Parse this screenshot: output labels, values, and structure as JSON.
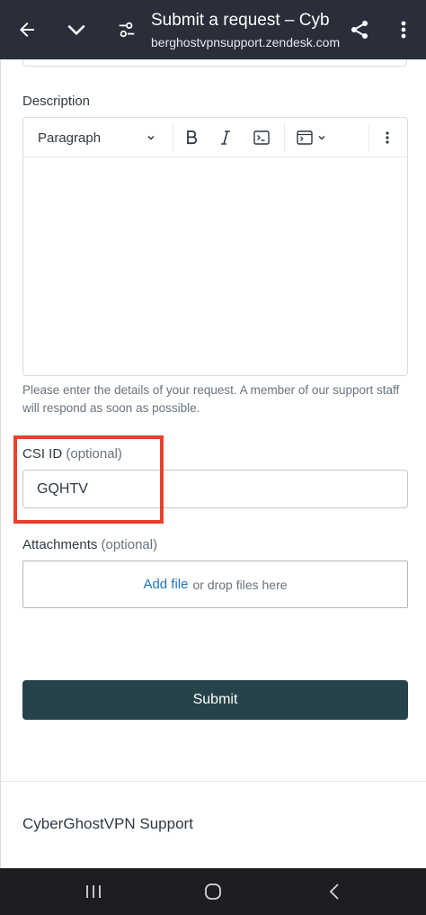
{
  "browser": {
    "title": "Submit a request – Cyb",
    "url": "berghostvpnsupport.zendesk.com",
    "icons": [
      "back-arrow-icon",
      "chevron-down-icon",
      "tune-icon",
      "share-icon",
      "more-vert-icon"
    ]
  },
  "form": {
    "description_label": "Description",
    "editor": {
      "paragraph_select": "Paragraph"
    },
    "description_hint": "Please enter the details of your request. A member of our support staff will respond as soon as possible.",
    "csi": {
      "label": "CSI ID",
      "optional": "(optional)",
      "value": "GQHTV"
    },
    "attachments": {
      "label": "Attachments",
      "optional": "(optional)",
      "add_file": "Add file",
      "drop_text": "or drop files here"
    },
    "submit_label": "Submit"
  },
  "footer": {
    "brand": "CyberGhostVPN Support"
  },
  "colors": {
    "topbar": "#2a2d3a",
    "submit": "#27434a",
    "link": "#1f73b7",
    "highlight": "#e8402b"
  }
}
